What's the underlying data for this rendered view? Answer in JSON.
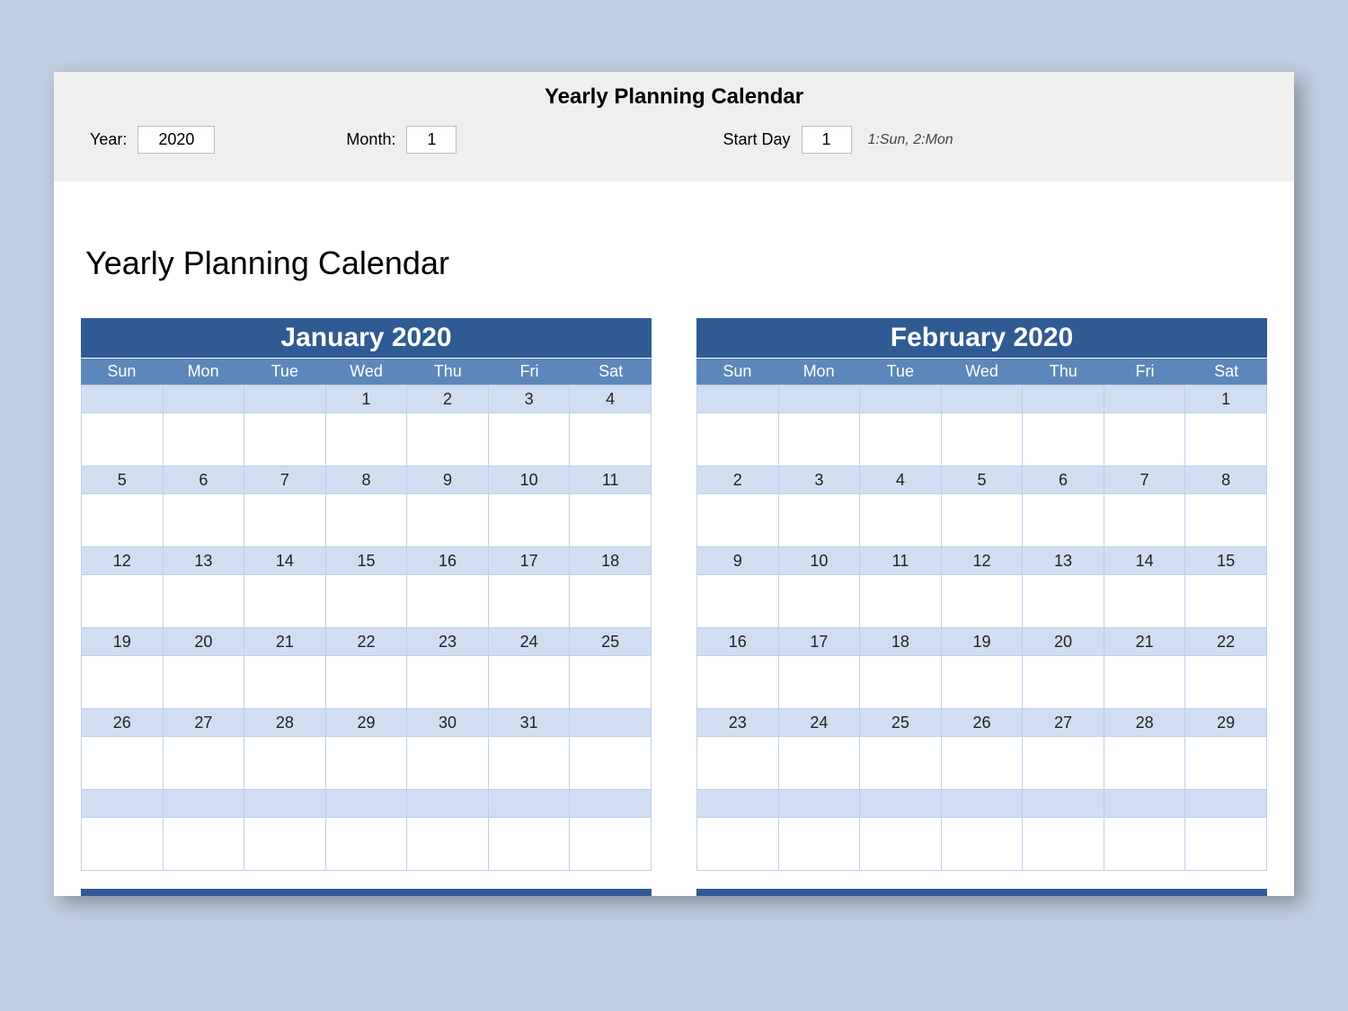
{
  "header": {
    "title": "Yearly Planning Calendar",
    "year_label": "Year:",
    "year_value": "2020",
    "month_label": "Month:",
    "month_value": "1",
    "startday_label": "Start Day",
    "startday_value": "1",
    "startday_hint": "1:Sun, 2:Mon"
  },
  "main_title": "Yearly Planning Calendar",
  "dow": [
    "Sun",
    "Mon",
    "Tue",
    "Wed",
    "Thu",
    "Fri",
    "Sat"
  ],
  "months": [
    {
      "title": "January 2020",
      "weeks": [
        [
          "",
          "",
          "",
          "1",
          "2",
          "3",
          "4"
        ],
        [
          "5",
          "6",
          "7",
          "8",
          "9",
          "10",
          "11"
        ],
        [
          "12",
          "13",
          "14",
          "15",
          "16",
          "17",
          "18"
        ],
        [
          "19",
          "20",
          "21",
          "22",
          "23",
          "24",
          "25"
        ],
        [
          "26",
          "27",
          "28",
          "29",
          "30",
          "31",
          ""
        ],
        [
          "",
          "",
          "",
          "",
          "",
          "",
          ""
        ]
      ]
    },
    {
      "title": "February 2020",
      "weeks": [
        [
          "",
          "",
          "",
          "",
          "",
          "",
          "1"
        ],
        [
          "2",
          "3",
          "4",
          "5",
          "6",
          "7",
          "8"
        ],
        [
          "9",
          "10",
          "11",
          "12",
          "13",
          "14",
          "15"
        ],
        [
          "16",
          "17",
          "18",
          "19",
          "20",
          "21",
          "22"
        ],
        [
          "23",
          "24",
          "25",
          "26",
          "27",
          "28",
          "29"
        ],
        [
          "",
          "",
          "",
          "",
          "",
          "",
          ""
        ]
      ]
    }
  ]
}
